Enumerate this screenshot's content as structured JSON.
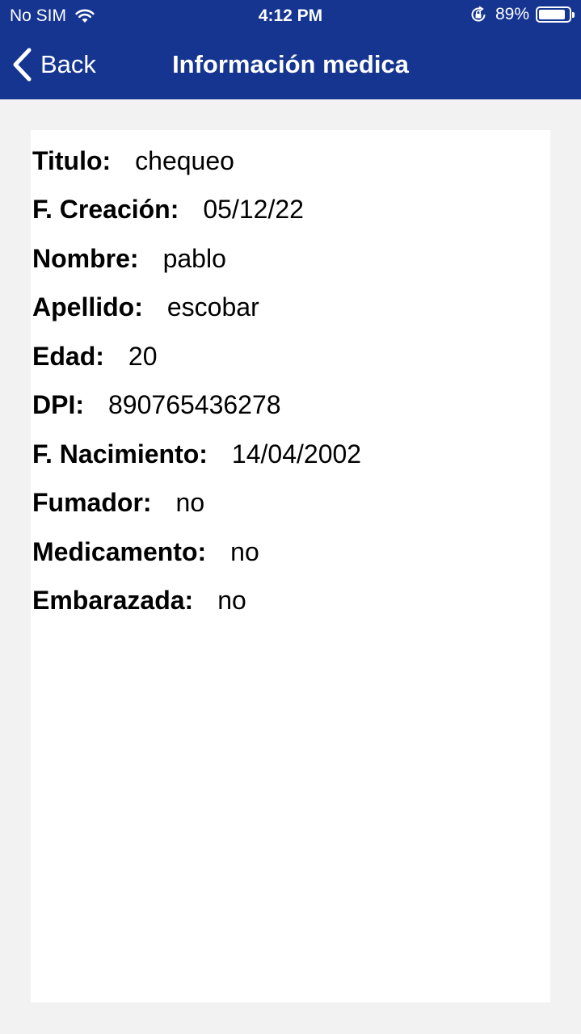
{
  "status_bar": {
    "carrier": "No SIM",
    "time": "4:12 PM",
    "battery_percent": "89%",
    "battery_level": 0.89,
    "icons": [
      "wifi-icon",
      "orientation-lock-icon",
      "battery-icon"
    ]
  },
  "navbar": {
    "back_label": "Back",
    "title": "Información medica",
    "background_color": "#153591"
  },
  "fields": [
    {
      "label": "Titulo:",
      "value": "chequeo"
    },
    {
      "label": "F. Creación:",
      "value": "05/12/22"
    },
    {
      "label": "Nombre:",
      "value": "pablo"
    },
    {
      "label": "Apellido:",
      "value": "escobar"
    },
    {
      "label": "Edad:",
      "value": "20"
    },
    {
      "label": "DPI:",
      "value": "890765436278"
    },
    {
      "label": "F. Nacimiento:",
      "value": "14/04/2002"
    },
    {
      "label": "Fumador:",
      "value": "no"
    },
    {
      "label": "Medicamento:",
      "value": "no"
    },
    {
      "label": "Embarazada:",
      "value": "no"
    }
  ]
}
